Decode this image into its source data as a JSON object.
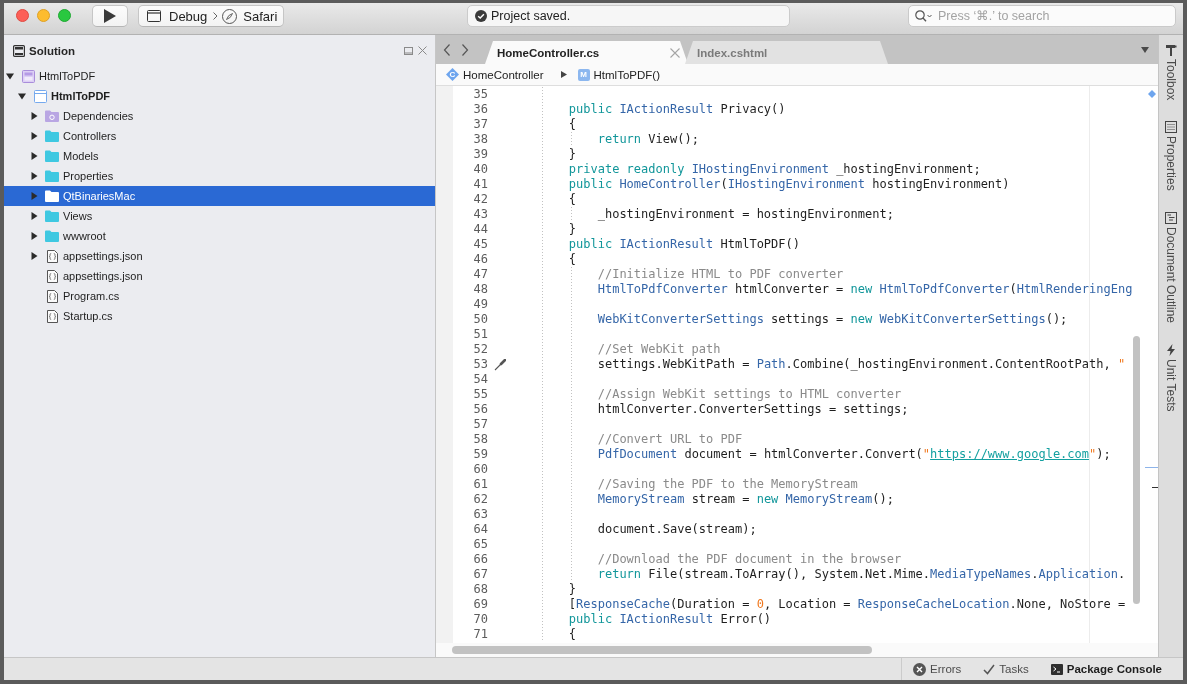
{
  "toolbar": {
    "configuration": "Debug",
    "device": "Safari",
    "status": "Project saved.",
    "search": {
      "placeholder": "Press ‘⌘.’ to search"
    }
  },
  "solution_pad": {
    "title": "Solution",
    "tree": [
      {
        "label": "HtmlToPDF",
        "kind": "solution",
        "expanded": true,
        "selected": false,
        "children": [
          {
            "label": "HtmlToPDF",
            "kind": "project",
            "expanded": true,
            "selected": false,
            "children": [
              {
                "label": "Dependencies",
                "kind": "dependencies",
                "expanded": false,
                "selected": false
              },
              {
                "label": "Controllers",
                "kind": "folder",
                "expanded": false,
                "selected": false
              },
              {
                "label": "Models",
                "kind": "folder",
                "expanded": false,
                "selected": false
              },
              {
                "label": "Properties",
                "kind": "folder",
                "expanded": false,
                "selected": false
              },
              {
                "label": "QtBinariesMac",
                "kind": "folder",
                "expanded": false,
                "selected": true
              },
              {
                "label": "Views",
                "kind": "folder",
                "expanded": false,
                "selected": false
              },
              {
                "label": "wwwroot",
                "kind": "folder",
                "expanded": false,
                "selected": false
              },
              {
                "label": "appsettings.json",
                "kind": "file",
                "expanded": false,
                "selected": false
              },
              {
                "label": "appsettings.json",
                "kind": "file",
                "selected": false
              },
              {
                "label": "Program.cs",
                "kind": "file",
                "selected": false
              },
              {
                "label": "Startup.cs",
                "kind": "file",
                "selected": false
              }
            ]
          }
        ]
      }
    ]
  },
  "editor": {
    "tabs": [
      {
        "label": "HomeController.cs",
        "selected": true
      },
      {
        "label": "Index.cshtml",
        "selected": false
      }
    ],
    "breadcrumb": [
      {
        "label": "HomeController",
        "kind": "class",
        "symbol": "C"
      },
      {
        "label": "HtmlToPDF()",
        "kind": "method",
        "symbol": "M"
      }
    ],
    "lines": [
      {
        "number": "35",
        "quick_fix": false
      },
      {
        "number": "36",
        "quick_fix": false,
        "tokens": [
          {
            "kind": "keyword",
            "text": "        public "
          },
          {
            "kind": "type",
            "text": "IActionResult"
          },
          {
            "kind": "plain",
            "text": " Privacy()"
          }
        ]
      },
      {
        "number": "37",
        "quick_fix": false,
        "tokens": [
          {
            "kind": "plain",
            "text": "        {"
          }
        ]
      },
      {
        "number": "38",
        "quick_fix": false,
        "tokens": [
          {
            "kind": "keyword",
            "text": "            return "
          },
          {
            "kind": "plain",
            "text": "View();"
          }
        ]
      },
      {
        "number": "39",
        "quick_fix": false,
        "tokens": [
          {
            "kind": "plain",
            "text": "        }"
          }
        ]
      },
      {
        "number": "40",
        "quick_fix": false,
        "tokens": [
          {
            "kind": "keyword",
            "text": "        private readonly "
          },
          {
            "kind": "type",
            "text": "IHostingEnvironment"
          },
          {
            "kind": "plain",
            "text": " _hostingEnvironment;"
          }
        ]
      },
      {
        "number": "41",
        "quick_fix": false,
        "tokens": [
          {
            "kind": "keyword",
            "text": "        public "
          },
          {
            "kind": "type",
            "text": "HomeController"
          },
          {
            "kind": "plain",
            "text": "("
          },
          {
            "kind": "type",
            "text": "IHostingEnvironment"
          },
          {
            "kind": "plain",
            "text": " hostingEnvironment)"
          }
        ]
      },
      {
        "number": "42",
        "quick_fix": false,
        "tokens": [
          {
            "kind": "plain",
            "text": "        {"
          }
        ]
      },
      {
        "number": "43",
        "quick_fix": false,
        "tokens": [
          {
            "kind": "plain",
            "text": "            _hostingEnvironment = hostingEnvironment;"
          }
        ]
      },
      {
        "number": "44",
        "quick_fix": false,
        "tokens": [
          {
            "kind": "plain",
            "text": "        }"
          }
        ]
      },
      {
        "number": "45",
        "quick_fix": false,
        "tokens": [
          {
            "kind": "keyword",
            "text": "        public "
          },
          {
            "kind": "type",
            "text": "IActionResult"
          },
          {
            "kind": "plain",
            "text": " HtmlToPDF()"
          }
        ]
      },
      {
        "number": "46",
        "quick_fix": false,
        "tokens": [
          {
            "kind": "plain",
            "text": "        {"
          }
        ]
      },
      {
        "number": "47",
        "quick_fix": false,
        "tokens": [
          {
            "kind": "comment",
            "text": "            //Initialize HTML to PDF converter"
          }
        ]
      },
      {
        "number": "48",
        "quick_fix": false,
        "tokens": [
          {
            "kind": "type",
            "text": "            HtmlToPdfConverter"
          },
          {
            "kind": "plain",
            "text": " htmlConverter = "
          },
          {
            "kind": "keyword",
            "text": "new "
          },
          {
            "kind": "type",
            "text": "HtmlToPdfConverter"
          },
          {
            "kind": "plain",
            "text": "("
          },
          {
            "kind": "type",
            "text": "HtmlRenderingEng"
          }
        ]
      },
      {
        "number": "49",
        "quick_fix": false
      },
      {
        "number": "50",
        "quick_fix": false,
        "tokens": [
          {
            "kind": "type",
            "text": "            WebKitConverterSettings"
          },
          {
            "kind": "plain",
            "text": " settings = "
          },
          {
            "kind": "keyword",
            "text": "new "
          },
          {
            "kind": "type",
            "text": "WebKitConverterSettings"
          },
          {
            "kind": "plain",
            "text": "();"
          }
        ]
      },
      {
        "number": "51",
        "quick_fix": false
      },
      {
        "number": "52",
        "quick_fix": false,
        "tokens": [
          {
            "kind": "comment",
            "text": "            //Set WebKit path"
          }
        ]
      },
      {
        "number": "53",
        "quick_fix": true,
        "tokens": [
          {
            "kind": "plain",
            "text": "            settings.WebKitPath = "
          },
          {
            "kind": "type",
            "text": "Path"
          },
          {
            "kind": "plain",
            "text": ".Combine(_hostingEnvironment.ContentRootPath, "
          },
          {
            "kind": "string",
            "text": "\""
          }
        ]
      },
      {
        "number": "54",
        "quick_fix": false
      },
      {
        "number": "55",
        "quick_fix": false,
        "tokens": [
          {
            "kind": "comment",
            "text": "            //Assign WebKit settings to HTML converter"
          }
        ]
      },
      {
        "number": "56",
        "quick_fix": false,
        "tokens": [
          {
            "kind": "plain",
            "text": "            htmlConverter.ConverterSettings = settings;"
          }
        ]
      },
      {
        "number": "57",
        "quick_fix": false
      },
      {
        "number": "58",
        "quick_fix": false,
        "tokens": [
          {
            "kind": "comment",
            "text": "            //Convert URL to PDF"
          }
        ]
      },
      {
        "number": "59",
        "quick_fix": false,
        "tokens": [
          {
            "kind": "type",
            "text": "            PdfDocument"
          },
          {
            "kind": "plain",
            "text": " document = htmlConverter.Convert("
          },
          {
            "kind": "string",
            "text": "\""
          },
          {
            "kind": "link",
            "text": "https://www.google.com"
          },
          {
            "kind": "string",
            "text": "\""
          },
          {
            "kind": "plain",
            "text": ");"
          }
        ]
      },
      {
        "number": "60",
        "quick_fix": false
      },
      {
        "number": "61",
        "quick_fix": false,
        "tokens": [
          {
            "kind": "comment",
            "text": "            //Saving the PDF to the MemoryStream"
          }
        ]
      },
      {
        "number": "62",
        "quick_fix": false,
        "tokens": [
          {
            "kind": "type",
            "text": "            MemoryStream"
          },
          {
            "kind": "plain",
            "text": " stream = "
          },
          {
            "kind": "keyword",
            "text": "new "
          },
          {
            "kind": "type",
            "text": "MemoryStream"
          },
          {
            "kind": "plain",
            "text": "();"
          }
        ]
      },
      {
        "number": "63",
        "quick_fix": false
      },
      {
        "number": "64",
        "quick_fix": false,
        "tokens": [
          {
            "kind": "plain",
            "text": "            document.Save(stream);"
          }
        ]
      },
      {
        "number": "65",
        "quick_fix": false
      },
      {
        "number": "66",
        "quick_fix": false,
        "tokens": [
          {
            "kind": "comment",
            "text": "            //Download the PDF document in the browser"
          }
        ]
      },
      {
        "number": "67",
        "quick_fix": false,
        "tokens": [
          {
            "kind": "keyword",
            "text": "            return "
          },
          {
            "kind": "plain",
            "text": "File(stream.ToArray(), System.Net.Mime."
          },
          {
            "kind": "type",
            "text": "MediaTypeNames"
          },
          {
            "kind": "plain",
            "text": "."
          },
          {
            "kind": "type",
            "text": "Application"
          },
          {
            "kind": "plain",
            "text": "."
          }
        ]
      },
      {
        "number": "68",
        "quick_fix": false,
        "tokens": [
          {
            "kind": "plain",
            "text": "        }"
          }
        ]
      },
      {
        "number": "69",
        "quick_fix": false,
        "tokens": [
          {
            "kind": "plain",
            "text": "        ["
          },
          {
            "kind": "type",
            "text": "ResponseCache"
          },
          {
            "kind": "plain",
            "text": "(Duration = "
          },
          {
            "kind": "number",
            "text": "0"
          },
          {
            "kind": "plain",
            "text": ", Location = "
          },
          {
            "kind": "type",
            "text": "ResponseCacheLocation"
          },
          {
            "kind": "plain",
            "text": ".None, NoStore ="
          }
        ]
      },
      {
        "number": "70",
        "quick_fix": false,
        "tokens": [
          {
            "kind": "keyword",
            "text": "        public "
          },
          {
            "kind": "type",
            "text": "IActionResult"
          },
          {
            "kind": "plain",
            "text": " Error()"
          }
        ]
      },
      {
        "number": "71",
        "quick_fix": false,
        "tokens": [
          {
            "kind": "plain",
            "text": "        {"
          }
        ]
      }
    ]
  },
  "side_pads": [
    {
      "label": "Toolbox",
      "kind": "toolbox"
    },
    {
      "label": "Properties",
      "kind": "properties"
    },
    {
      "label": "Document Outline",
      "kind": "outline"
    },
    {
      "label": "Unit Tests",
      "kind": "tests"
    }
  ],
  "status_bar": [
    {
      "label": "Errors",
      "kind": "errors",
      "highlighted": false
    },
    {
      "label": "Tasks",
      "kind": "tasks",
      "highlighted": false
    },
    {
      "label": "Package Console",
      "kind": "console",
      "highlighted": true
    }
  ]
}
